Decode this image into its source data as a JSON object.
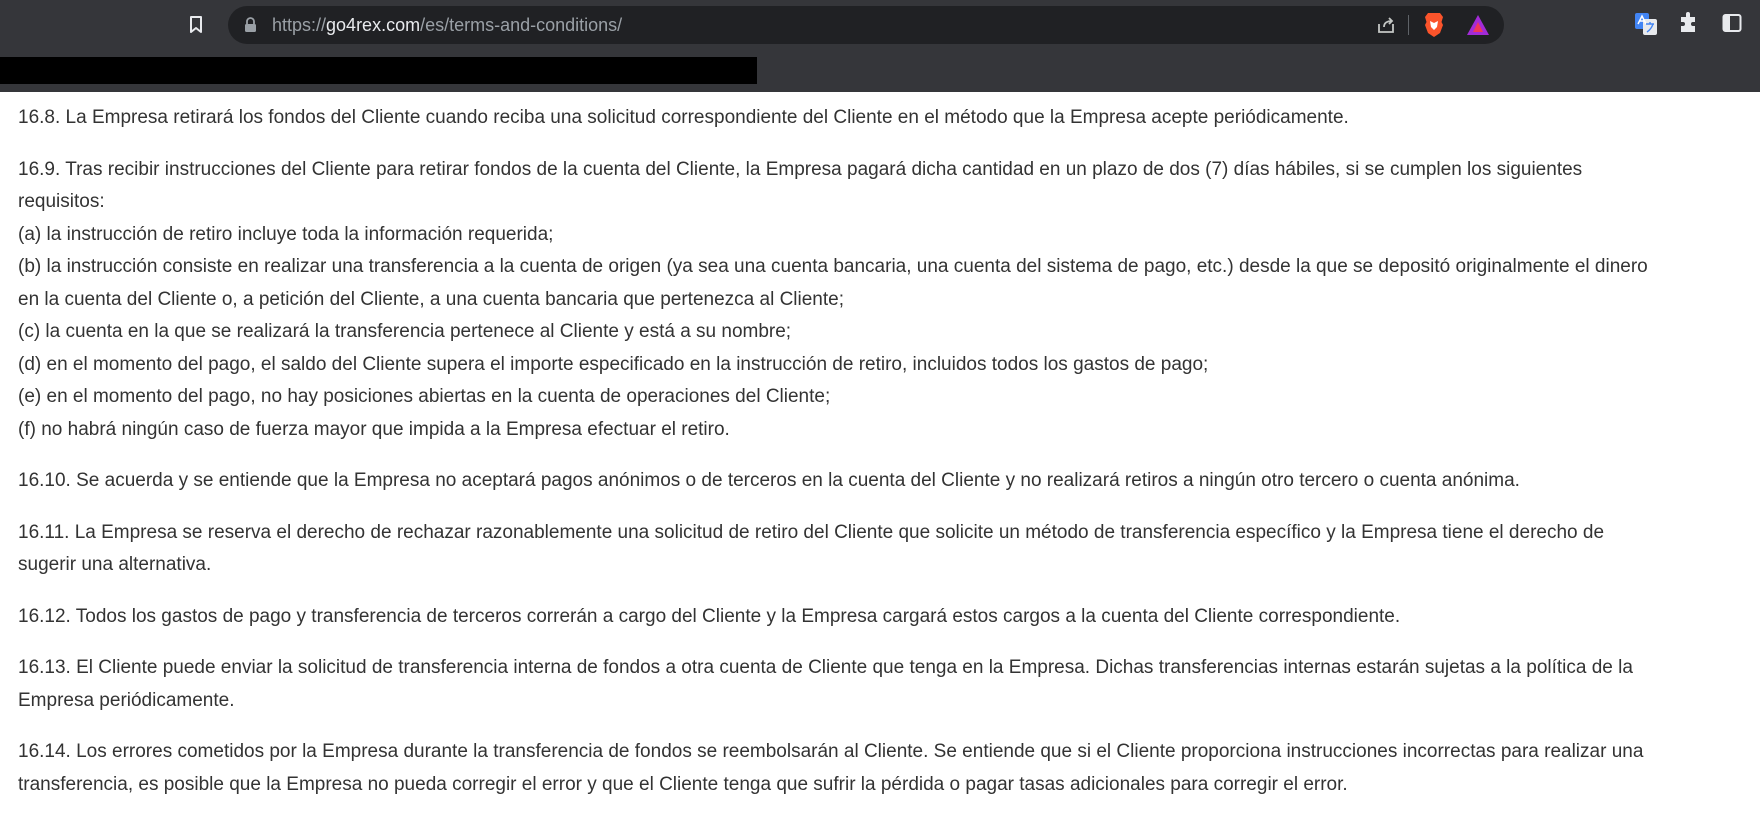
{
  "browser": {
    "url_scheme": "https://",
    "url_host": "go4rex.com",
    "url_path": "/es/terms-and-conditions/"
  },
  "colors": {
    "toolbar_bg": "#35363a",
    "omnibox_bg": "#202124",
    "brave_orange": "#fb542b",
    "text": "#333333"
  },
  "content": {
    "p1": [
      "16.8. La Empresa retirará los fondos del Cliente cuando reciba una solicitud correspondiente del Cliente en el método que la Empresa acepte periódicamente."
    ],
    "p2": [
      "16.9. Tras recibir instrucciones del Cliente para retirar fondos de la cuenta del Cliente, la Empresa pagará dicha cantidad en un plazo de dos (7) días hábiles, si se cumplen los siguientes",
      "requisitos:",
      "(a) la instrucción de retiro incluye toda la información requerida;",
      "(b) la instrucción consiste en realizar una transferencia a la cuenta de origen (ya sea una cuenta bancaria, una cuenta del sistema de pago, etc.) desde la que se depositó originalmente el dinero",
      "en la cuenta del Cliente o, a petición del Cliente, a una cuenta bancaria que pertenezca al Cliente;",
      "(c) la cuenta en la que se realizará la transferencia pertenece al Cliente y está a su nombre;",
      "(d) en el momento del pago, el saldo del Cliente supera el importe especificado en la instrucción de retiro, incluidos todos los gastos de pago;",
      "(e) en el momento del pago, no hay posiciones abiertas en la cuenta de operaciones del Cliente;",
      "(f) no habrá ningún caso de fuerza mayor que impida a la Empresa efectuar el retiro."
    ],
    "p3": [
      "16.10. Se acuerda y se entiende que la Empresa no aceptará pagos anónimos o de terceros en la cuenta del Cliente y no realizará retiros a ningún otro tercero o cuenta anónima."
    ],
    "p4": [
      "16.11. La Empresa se reserva el derecho de rechazar razonablemente una solicitud de retiro del Cliente que solicite un método de transferencia específico y la Empresa tiene el derecho de",
      "sugerir una alternativa."
    ],
    "p5": [
      "16.12. Todos los gastos de pago y transferencia de terceros correrán a cargo del Cliente y la Empresa cargará estos cargos a la cuenta del Cliente correspondiente."
    ],
    "p6": [
      "16.13. El Cliente puede enviar la solicitud de transferencia interna de fondos a otra cuenta de Cliente que tenga en la Empresa. Dichas transferencias internas estarán sujetas a la política de la",
      "Empresa periódicamente."
    ],
    "p7": [
      "16.14. Los errores cometidos por la Empresa durante la transferencia de fondos se reembolsarán al Cliente. Se entiende que si el Cliente proporciona instrucciones incorrectas para realizar una",
      "transferencia, es posible que la Empresa no pueda corregir el error y que el Cliente tenga que sufrir la pérdida o pagar tasas adicionales para corregir el error."
    ]
  }
}
